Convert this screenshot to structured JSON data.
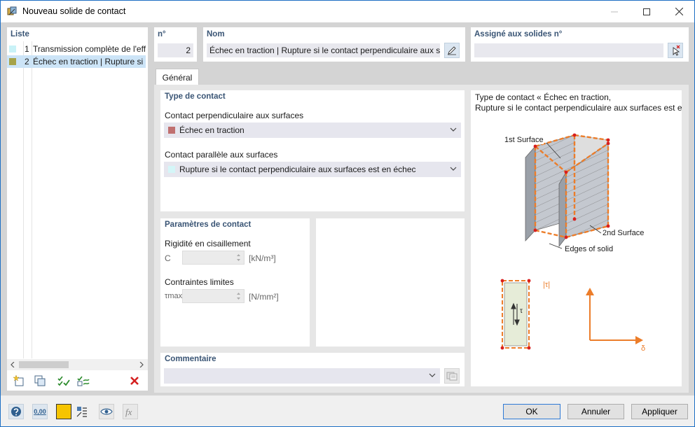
{
  "window": {
    "title": "Nouveau solide de contact"
  },
  "list": {
    "header": "Liste",
    "items": [
      {
        "num": "1",
        "label": "Transmission complète de l'effo",
        "color": "#c9f2f7"
      },
      {
        "num": "2",
        "label": "Échec en traction | Rupture si le",
        "color": "#a6a34a"
      }
    ]
  },
  "no": {
    "label": "n°",
    "value": "2"
  },
  "nom": {
    "label": "Nom",
    "value": "Échec en traction | Rupture si le contact perpendiculaire aux sur"
  },
  "assigned": {
    "label": "Assigné aux solides n°",
    "value": ""
  },
  "tabs": [
    {
      "label": "Général"
    }
  ],
  "contact_type": {
    "header": "Type de contact",
    "perp_label": "Contact perpendiculaire aux surfaces",
    "perp_value": "Échec en traction",
    "perp_color": "#c07070",
    "par_label": "Contact parallèle aux surfaces",
    "par_value": "Rupture si le contact perpendiculaire aux surfaces est en échec",
    "par_color": "#d4f6f8"
  },
  "params": {
    "header": "Paramètres de contact",
    "shear_label": "Rigidité en cisaillement",
    "shear_symbol": "C",
    "shear_unit": "[kN/m³]",
    "limit_label": "Contraintes limites",
    "limit_symbol": "τmax",
    "limit_unit": "[N/mm²]"
  },
  "comment": {
    "header": "Commentaire",
    "value": ""
  },
  "preview": {
    "caption_line1": "Type de contact « Échec en traction,",
    "caption_line2": "Rupture si le contact perpendiculaire aux surfaces est en é",
    "label_1st": "1st Surface",
    "label_2nd": "2nd Surface",
    "label_edges": "Edges of solid",
    "label_tau_abs": "|τ|",
    "label_tau": "τ",
    "label_delta": "δ"
  },
  "footer": {
    "ok": "OK",
    "cancel": "Annuler",
    "apply": "Appliquer",
    "units_icon_text": "0,00"
  }
}
